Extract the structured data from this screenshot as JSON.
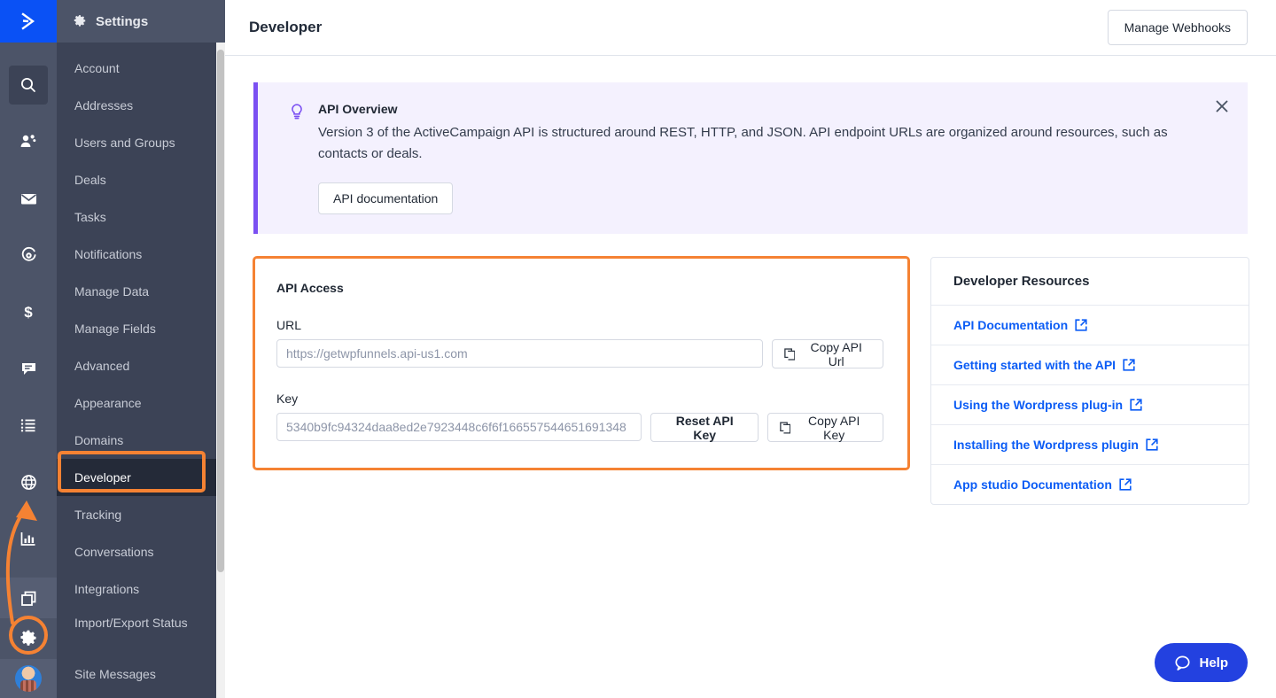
{
  "brand": {
    "logo_icon": "activecampaign-chevron-logo",
    "accent": "#0a51f5",
    "annotation_color": "#f58233"
  },
  "rail": {
    "items": [
      {
        "name": "search",
        "icon": "search-icon",
        "active": true
      },
      {
        "name": "contacts",
        "icon": "contacts-icon",
        "active": false
      },
      {
        "name": "campaigns",
        "icon": "envelope-icon",
        "active": false
      },
      {
        "name": "automations",
        "icon": "automations-gear-circle-icon",
        "active": false
      },
      {
        "name": "deals",
        "icon": "dollar-icon",
        "active": false
      },
      {
        "name": "conversations",
        "icon": "chat-icon",
        "active": false
      },
      {
        "name": "lists",
        "icon": "list-icon",
        "active": false
      },
      {
        "name": "website",
        "icon": "globe-icon",
        "active": false
      },
      {
        "name": "reports",
        "icon": "bar-chart-icon",
        "active": false
      }
    ],
    "bottom": [
      {
        "name": "apps",
        "icon": "apps-copy-icon"
      },
      {
        "name": "settings",
        "icon": "gear-icon",
        "annotated": true
      },
      {
        "name": "profile",
        "icon": "avatar"
      }
    ]
  },
  "sidebar": {
    "title": "Settings",
    "title_icon": "gear-icon",
    "items": [
      {
        "label": "Account",
        "selected": false
      },
      {
        "label": "Addresses",
        "selected": false
      },
      {
        "label": "Users and Groups",
        "selected": false
      },
      {
        "label": "Deals",
        "selected": false
      },
      {
        "label": "Tasks",
        "selected": false
      },
      {
        "label": "Notifications",
        "selected": false
      },
      {
        "label": "Manage Data",
        "selected": false
      },
      {
        "label": "Manage Fields",
        "selected": false
      },
      {
        "label": "Advanced",
        "selected": false
      },
      {
        "label": "Appearance",
        "selected": false
      },
      {
        "label": "Domains",
        "selected": false
      },
      {
        "label": "Developer",
        "selected": true
      },
      {
        "label": "Tracking",
        "selected": false
      },
      {
        "label": "Conversations",
        "selected": false
      },
      {
        "label": "Integrations",
        "selected": false
      },
      {
        "label": "Import/Export Status",
        "selected": false
      },
      {
        "label": "Site Messages",
        "selected": false
      }
    ]
  },
  "header": {
    "title": "Developer",
    "manage_webhooks_label": "Manage Webhooks"
  },
  "banner": {
    "icon": "lightbulb-icon",
    "title": "API Overview",
    "text": "Version 3 of the ActiveCampaign API is structured around REST, HTTP, and JSON. API endpoint URLs are organized around resources, such as contacts or deals.",
    "button_label": "API documentation",
    "close_icon": "close-icon"
  },
  "api_access": {
    "heading": "API Access",
    "url_label": "URL",
    "url_value": "https://getwpfunnels.api-us1.com",
    "copy_url_label": "Copy API Url",
    "copy_url_icon": "copy-icon",
    "key_label": "Key",
    "key_value": "5340b9fc94324daa8ed2e7923448c6f6f166557544651691348",
    "reset_key_label": "Reset API Key",
    "copy_key_label": "Copy API Key",
    "copy_key_icon": "copy-icon"
  },
  "resources": {
    "heading": "Developer Resources",
    "items": [
      {
        "label": "API Documentation",
        "icon": "external-link-icon"
      },
      {
        "label": "Getting started with the API",
        "icon": "external-link-icon"
      },
      {
        "label": "Using the Wordpress plug-in",
        "icon": "external-link-icon"
      },
      {
        "label": "Installing the Wordpress plugin",
        "icon": "external-link-icon"
      },
      {
        "label": "App studio Documentation",
        "icon": "external-link-icon"
      }
    ]
  },
  "help": {
    "label": "Help",
    "icon": "chat-bubble-icon"
  }
}
